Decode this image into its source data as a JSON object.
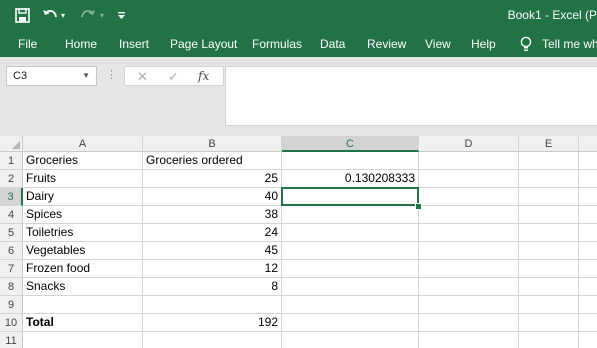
{
  "title_bar": {
    "document_title": "Book1  -  Excel (P",
    "icons": [
      "save-icon",
      "undo-icon",
      "redo-icon",
      "customize-quick-access-icon"
    ]
  },
  "ribbon": {
    "tabs": [
      "File",
      "Home",
      "Insert",
      "Page Layout",
      "Formulas",
      "Data",
      "Review",
      "View",
      "Help"
    ],
    "tell_me": "Tell me wha",
    "accent_color": "#217346"
  },
  "formula_bar": {
    "name_box": "C3",
    "function_label": "fx",
    "formula": ""
  },
  "sheet": {
    "columns": [
      "A",
      "B",
      "C",
      "D",
      "E"
    ],
    "rows": [
      "1",
      "2",
      "3",
      "4",
      "5",
      "6",
      "7",
      "8",
      "9",
      "10",
      "11"
    ],
    "selected_cell": "C3",
    "cells": {
      "A1": "Groceries",
      "B1": "Groceries ordered",
      "A2": "Fruits",
      "B2": "25",
      "C2": "0.130208333",
      "A3": "Dairy",
      "B3": "40",
      "A4": "Spices",
      "B4": "38",
      "A5": "Toiletries",
      "B5": "24",
      "A6": "Vegetables",
      "B6": "45",
      "A7": "Frozen food",
      "B7": "12",
      "A8": "Snacks",
      "B8": "8",
      "A10": "Total",
      "B10": "192"
    }
  }
}
